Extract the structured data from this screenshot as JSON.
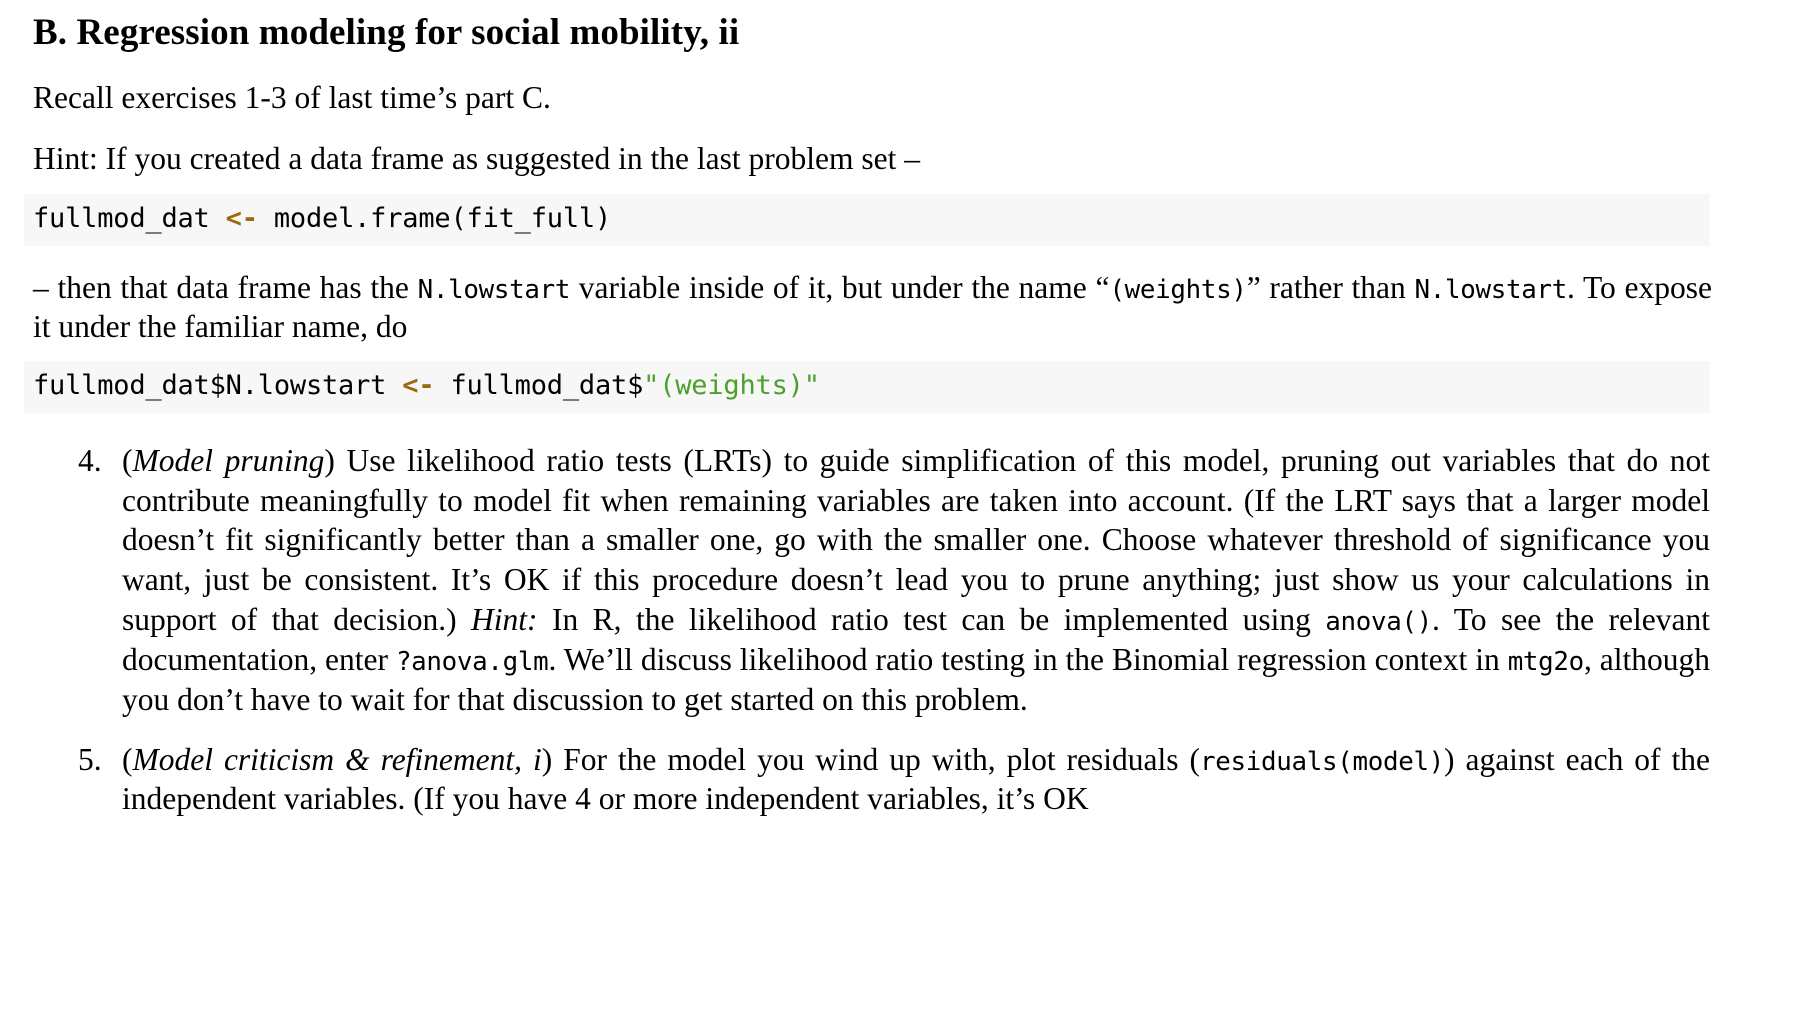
{
  "document": {
    "section_heading": "B. Regression modeling for social mobility, ii",
    "intro": {
      "recall": "Recall exercises 1-3 of last time’s part C.",
      "hint_lead": "Hint: If you created a data frame as suggested in the last problem set –"
    },
    "code_blocks": [
      {
        "id": "fullmod-dat-assign",
        "before": "fullmod_dat ",
        "assign_operator": "<-",
        "after": " model.frame(fit_full)",
        "background_color": "#f7f7f7",
        "assign_color": "#9b6a10"
      },
      {
        "id": "expose-weights",
        "before": "fullmod_dat$N.lowstart ",
        "assign_operator": "<-",
        "middle": " fullmod_dat$",
        "string_literal": "\"(weights)\"",
        "background_color": "#f7f7f7",
        "assign_color": "#9b6a10",
        "string_color": "#4ca12a"
      }
    ],
    "explain": {
      "part1": "– then that data frame has the ",
      "code1": "N.lowstart",
      "part2": " variable inside of it, but under the name “",
      "code2": "(weights)",
      "part3": "” rather than ",
      "code3": "N.lowstart",
      "part4": ". To expose it under the familiar name, do"
    },
    "exercises": [
      {
        "number": "4.",
        "title": "Model pruning",
        "segments": [
          {
            "type": "text",
            "value": "("
          },
          {
            "type": "italic",
            "value": "Model pruning"
          },
          {
            "type": "text",
            "value": ") Use likelihood ratio tests (LRTs) to guide simplification of this model, pruning out variables that do not contribute meaningfully to model fit when remaining variables are taken into account. (If the LRT says that a larger model doesn’t fit significantly better than a smaller one, go with the smaller one. Choose whatever threshold of significance you want, just be consistent. It’s OK if this procedure doesn’t lead you to prune anything; just show us your calculations in support of that decision.) "
          },
          {
            "type": "italic",
            "value": "Hint:"
          },
          {
            "type": "text",
            "value": " In R, the likelihood ratio test can be implemented using "
          },
          {
            "type": "code",
            "value": "anova()"
          },
          {
            "type": "text",
            "value": ". To see the relevant documentation, enter "
          },
          {
            "type": "code",
            "value": "?anova.glm"
          },
          {
            "type": "text",
            "value": ". We’ll discuss likelihood ratio testing in the Binomial regression context in "
          },
          {
            "type": "code",
            "value": "mtg2o"
          },
          {
            "type": "text",
            "value": ", although you don’t have to wait for that discussion to get started on this problem."
          }
        ]
      },
      {
        "number": "5.",
        "title": "Model criticism & refinement, i",
        "segments": [
          {
            "type": "text",
            "value": "("
          },
          {
            "type": "italic",
            "value": "Model criticism & refinement, i"
          },
          {
            "type": "text",
            "value": ") For the model you wind up with, plot residuals ("
          },
          {
            "type": "code",
            "value": "residuals(model)"
          },
          {
            "type": "text",
            "value": ") against each of the independent variables. (If you have 4 or more independent variables, it’s OK"
          }
        ]
      }
    ]
  }
}
